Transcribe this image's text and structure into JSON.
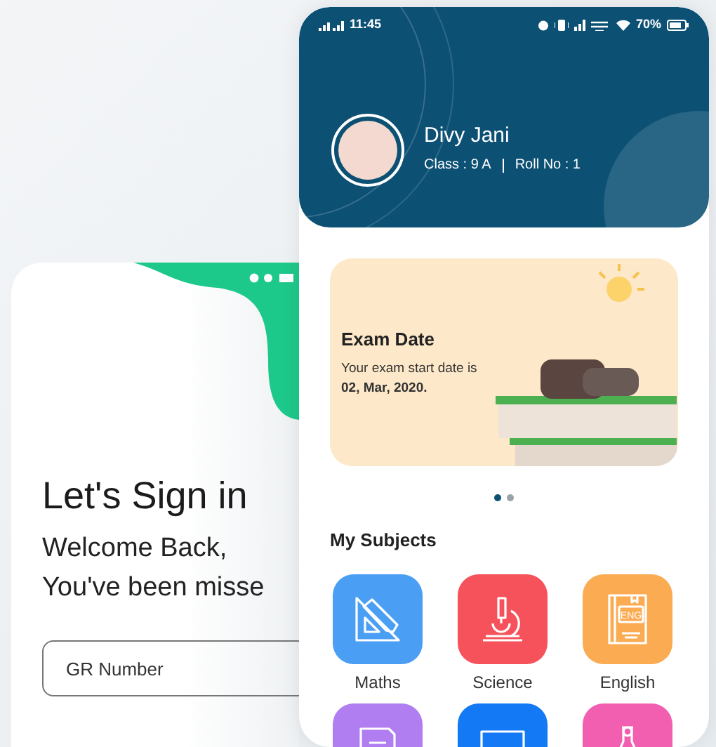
{
  "sign_in_screen": {
    "title": "Let's Sign in",
    "greeting_lines": [
      "Welcome Back,",
      "You've been misse"
    ],
    "gr_field": {
      "placeholder": "GR Number"
    }
  },
  "home_screen": {
    "status_bar": {
      "time": "11:45",
      "battery": "70%"
    },
    "profile": {
      "name": "Divy Jani",
      "class_label": "Class : 9 A",
      "roll_label": "Roll No : 1"
    },
    "banner": {
      "title": "Exam Date",
      "text": "Your exam start date is",
      "date": "02, Mar, 2020."
    },
    "carousel_dots": [
      {
        "selected": true
      },
      {
        "selected": false
      }
    ],
    "subjects_heading": "My Subjects",
    "subjects": [
      {
        "kind": "geometry",
        "name": "Maths",
        "color": "#4a9ff5"
      },
      {
        "kind": "microscope",
        "name": "Science",
        "color": "#f5525b"
      },
      {
        "kind": "book",
        "name": "English",
        "color": "#fbab52",
        "icon_text": "ENG"
      },
      {
        "kind": "document",
        "color": "#b07ef0"
      },
      {
        "kind": "monitor",
        "color": "#1479f5"
      },
      {
        "kind": "flask",
        "color": "#f25fb0"
      }
    ]
  }
}
